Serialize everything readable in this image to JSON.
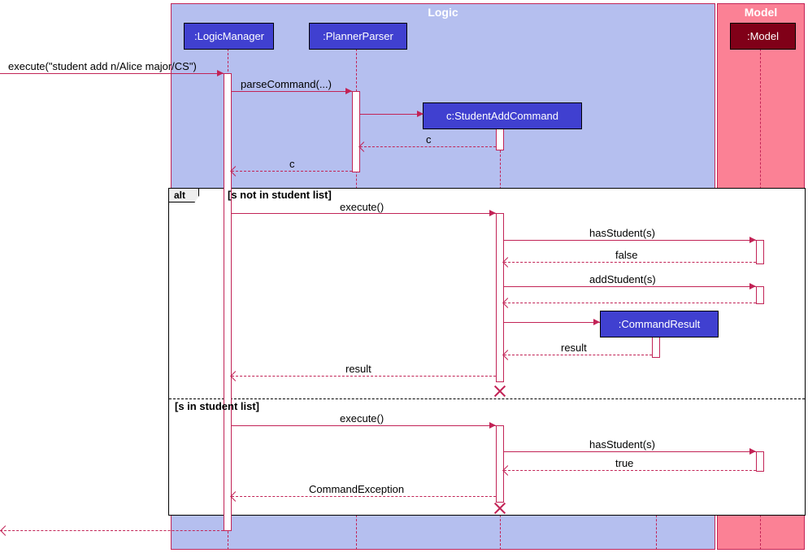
{
  "packages": {
    "logic": "Logic",
    "model": "Model"
  },
  "participants": {
    "logicManager": ":LogicManager",
    "plannerParser": ":PlannerParser",
    "studentAddCommand": "c:StudentAddCommand",
    "commandResult": ":CommandResult",
    "model": ":Model"
  },
  "messages": {
    "execute_initial": "execute(\"student add n/Alice major/CS\")",
    "parseCommand": "parseCommand(...)",
    "return_c1": "c",
    "return_c2": "c",
    "execute1": "execute()",
    "hasStudent1": "hasStudent(s)",
    "false": "false",
    "addStudent": "addStudent(s)",
    "result1": "result",
    "result2": "result",
    "execute2": "execute()",
    "hasStudent2": "hasStudent(s)",
    "true": "true",
    "commandException": "CommandException"
  },
  "alt": {
    "label": "alt",
    "guard1": "[s not in student list]",
    "guard2": "[s in student list]"
  }
}
